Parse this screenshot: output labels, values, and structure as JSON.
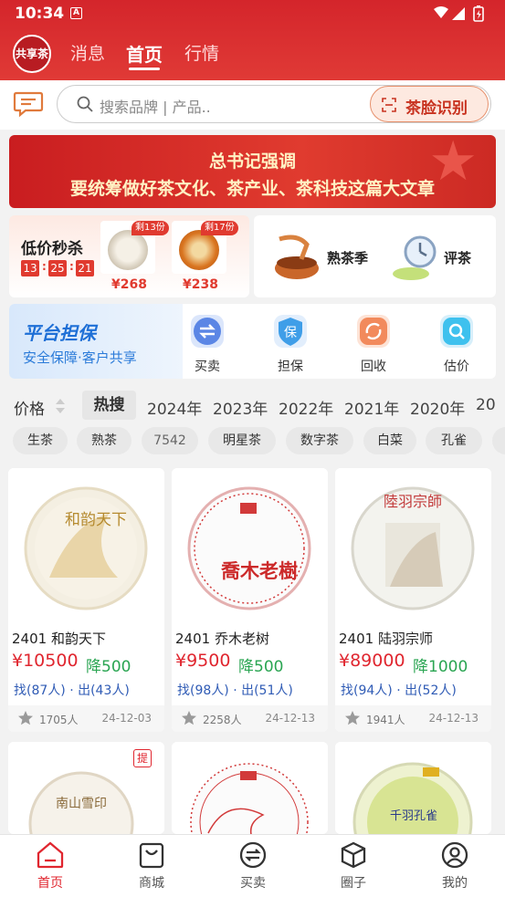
{
  "status_bar": {
    "time": "10:34",
    "notif": "A"
  },
  "header": {
    "logo_text": "共享茶",
    "tabs": [
      {
        "label": "消息"
      },
      {
        "label": "首页"
      },
      {
        "label": "行情"
      }
    ],
    "active_tab": "首页"
  },
  "search": {
    "placeholder": "搜索品牌 | 产品..",
    "face_button": "茶脸识别"
  },
  "banner": {
    "line1": "总书记强调",
    "line2": "要统筹做好茶文化、茶产业、茶科技这篇大文章"
  },
  "seckill": {
    "title": "低价秒杀",
    "countdown": [
      "13",
      "25",
      "21"
    ],
    "items": [
      {
        "badge": "剩13份",
        "price": "¥268"
      },
      {
        "badge": "剩17份",
        "price": "¥238"
      }
    ]
  },
  "season": {
    "item1": "熟茶季",
    "item2": "评茶"
  },
  "guarantee": {
    "title": "平台担保",
    "subtitle": "安全保障·客户共享",
    "items": [
      {
        "label": "买卖"
      },
      {
        "label": "担保"
      },
      {
        "label": "回收"
      },
      {
        "label": "估价"
      }
    ]
  },
  "filter": {
    "price_label": "价格",
    "hot_label": "热搜",
    "years": [
      "2024年",
      "2023年",
      "2022年",
      "2021年",
      "2020年",
      "20"
    ]
  },
  "tags": [
    "生茶",
    "熟茶",
    "7542",
    "明星茶",
    "数字茶",
    "白菜",
    "孔雀"
  ],
  "products": [
    {
      "name": "2401 和韵天下",
      "price": "¥10500",
      "drop": "降500",
      "stat": "找(87人) · 出(43人)",
      "people": "1705人",
      "date": "24-12-03",
      "cake_text": "和韵天下"
    },
    {
      "name": "2401 乔木老树",
      "price": "¥9500",
      "drop": "降500",
      "stat": "找(98人) · 出(51人)",
      "people": "2258人",
      "date": "24-12-13",
      "cake_text": "喬木老樹"
    },
    {
      "name": "2401 陆羽宗师",
      "price": "¥89000",
      "drop": "降1000",
      "stat": "找(94人) · 出(52人)",
      "people": "1941人",
      "date": "24-12-13",
      "cake_text": "陸羽宗師"
    },
    {
      "badge": "提",
      "cake_text": "南山雪印"
    },
    {
      "cake_text": ""
    },
    {
      "cake_text": "千羽孔雀"
    }
  ],
  "bottom_nav": [
    {
      "label": "首页",
      "icon": "home-icon"
    },
    {
      "label": "商城",
      "icon": "shop-bag-icon"
    },
    {
      "label": "买卖",
      "icon": "trade-icon"
    },
    {
      "label": "圈子",
      "icon": "cube-icon"
    },
    {
      "label": "我的",
      "icon": "user-icon"
    }
  ],
  "colors": {
    "brand_red": "#e0262f",
    "drop_green": "#2aa552",
    "stat_blue": "#2f5bb5"
  }
}
